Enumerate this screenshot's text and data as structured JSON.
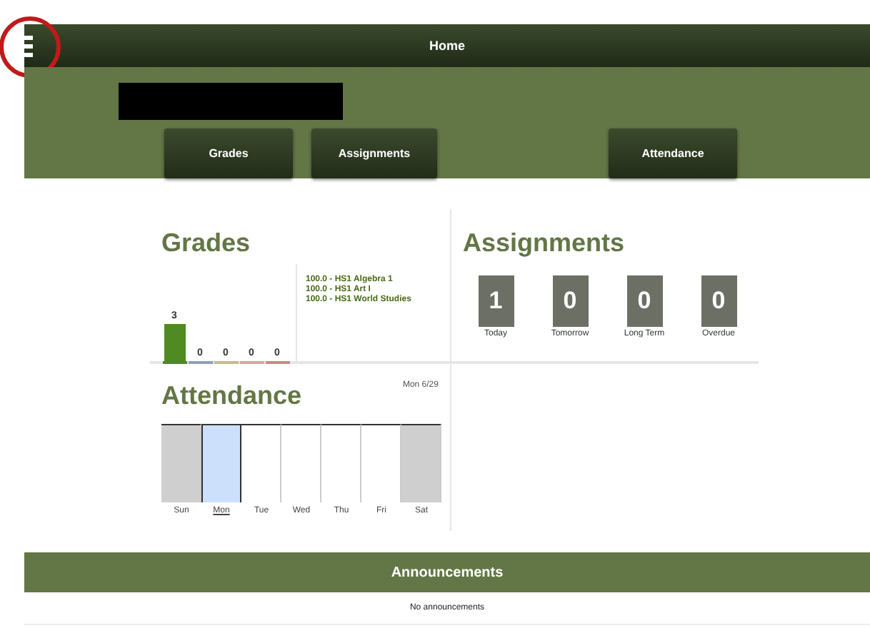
{
  "header": {
    "title": "Home"
  },
  "nav_buttons": [
    "Grades",
    "Assignments",
    "Attendance"
  ],
  "grades": {
    "title": "Grades",
    "bars": [
      {
        "count": "3",
        "color": "#4f8a23",
        "kind": "filled"
      },
      {
        "count": "0",
        "color": "#8f9ec2",
        "kind": "empty"
      },
      {
        "count": "0",
        "color": "#c9b98f",
        "kind": "empty"
      },
      {
        "count": "0",
        "color": "#d4a99a",
        "kind": "empty"
      },
      {
        "count": "0",
        "color": "#c98a86",
        "kind": "empty"
      }
    ],
    "courses": [
      "100.0 - HS1 Algebra 1",
      "100.0 - HS1 Art I",
      "100.0 - HS1 World Studies"
    ]
  },
  "assignments": {
    "title": "Assignments",
    "tiles": [
      {
        "count": "1",
        "label": "Today"
      },
      {
        "count": "0",
        "label": "Tomorrow"
      },
      {
        "count": "0",
        "label": "Long Term"
      },
      {
        "count": "0",
        "label": "Overdue"
      }
    ]
  },
  "attendance": {
    "title": "Attendance",
    "date": "Mon 6/29",
    "days": [
      {
        "label": "Sun",
        "kind": "weekend",
        "selected": false
      },
      {
        "label": "Mon",
        "kind": "weekday",
        "selected": true
      },
      {
        "label": "Tue",
        "kind": "weekday",
        "selected": false
      },
      {
        "label": "Wed",
        "kind": "weekday",
        "selected": false
      },
      {
        "label": "Thu",
        "kind": "weekday",
        "selected": false
      },
      {
        "label": "Fri",
        "kind": "weekday",
        "selected": false
      },
      {
        "label": "Sat",
        "kind": "weekend",
        "selected": false
      }
    ]
  },
  "announcements": {
    "title": "Announcements",
    "message": "No announcements"
  }
}
